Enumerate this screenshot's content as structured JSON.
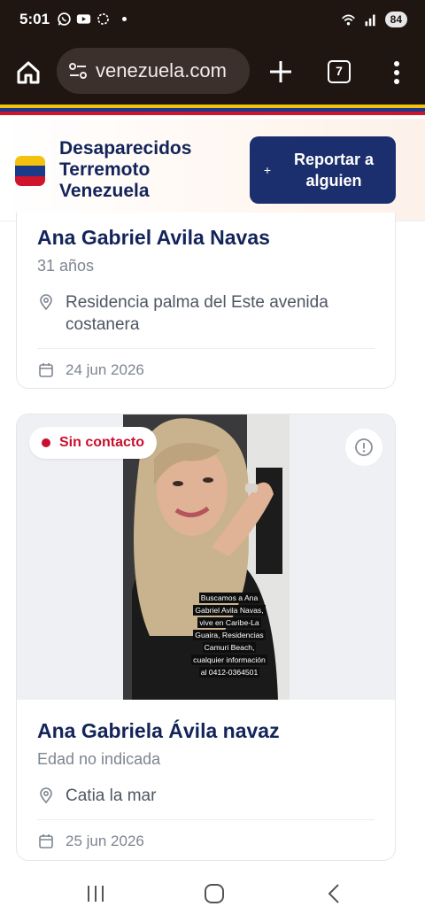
{
  "status_bar": {
    "time": "5:01",
    "battery": "84",
    "icons": [
      "whatsapp-icon",
      "youtube-icon",
      "sync-icon",
      "wifi-icon",
      "signal-icon"
    ]
  },
  "browser": {
    "url": "venezuela.com",
    "tab_count": "7"
  },
  "header": {
    "title_lines": [
      "Desaparecidos",
      "Terremoto",
      "Venezuela"
    ],
    "report_button": "Reportar a alguien",
    "flag_colors": [
      "#f4c20d",
      "#1b3b8a",
      "#cf142b"
    ]
  },
  "cards": [
    {
      "name": "Ana Gabriel Avila Navas",
      "age": "31 años",
      "location": "Residencia palma del Este avenida costanera",
      "date": "24 jun 2026"
    },
    {
      "status": "Sin contacto",
      "photo_caption": "Buscamos a Ana Gabriel Avila Navas, vive en Caribe-La Guaira, Residencias Camuri Beach, cualquier información al 0412-0364501",
      "name": "Ana Gabriela Ávila navaz",
      "age": "Edad no indicada",
      "location": "Catia la mar",
      "date": "25 jun 2026"
    }
  ],
  "colors": {
    "brand_navy": "#1b2f6e",
    "status_red": "#c8102e",
    "browser_bg": "#1f1612"
  }
}
